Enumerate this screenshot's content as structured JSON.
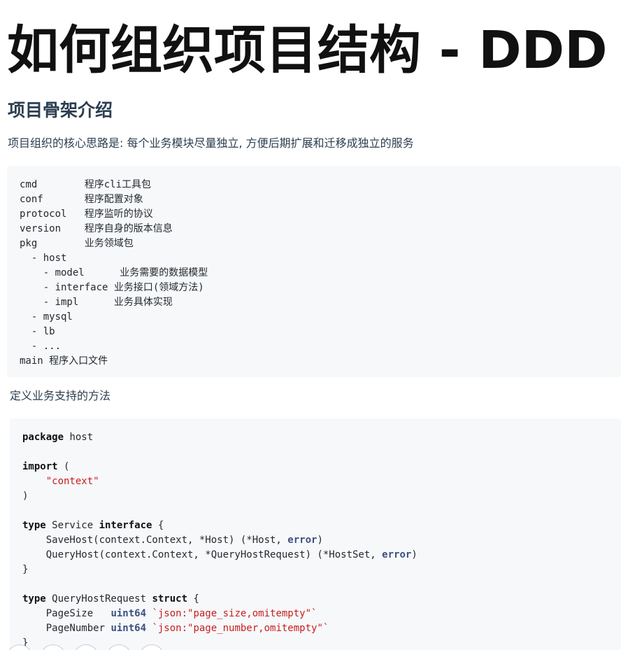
{
  "title": "如何组织项目结构 - DDD",
  "section_heading": "项目骨架介绍",
  "intro_paragraph": "项目组织的核心思路是: 每个业务模块尽量独立, 方便后期扩展和迁移成独立的服务",
  "tree_block": {
    "lines": [
      "cmd        程序cli工具包",
      "conf       程序配置对象",
      "protocol   程序监听的协议",
      "version    程序自身的版本信息",
      "pkg        业务领域包",
      "  - host",
      "    - model      业务需要的数据模型",
      "    - interface 业务接口(领域方法)",
      "    - impl      业务具体实现",
      "  - mysql",
      "  - lb",
      "  - ...",
      "main 程序入口文件"
    ]
  },
  "method_paragraph": "定义业务支持的方法",
  "go_block": {
    "kw_package": "package",
    "pkg_name": " host",
    "kw_import": "import",
    "import_open": " (",
    "import_indent": "    ",
    "import_path": "\"context\"",
    "import_close": ")",
    "kw_type": "type",
    "service_name": " Service ",
    "kw_interface": "interface",
    "brace_open": " {",
    "save_host_sig": "    SaveHost(context.Context, *Host) (*Host, ",
    "query_host_sig": "    QueryHost(context.Context, *QueryHostRequest) (*HostSet, ",
    "type_error": "error",
    "paren_close": ")",
    "brace_close": "}",
    "req_name": " QueryHostRequest ",
    "kw_struct": "struct",
    "field_page_size": "    PageSize   ",
    "field_page_number": "    PageNumber ",
    "type_uint64": "uint64",
    "tag_page_size": " `json:\"page_size,omitempty\"`",
    "tag_page_number": " `json:\"page_number,omitempty\"`"
  }
}
